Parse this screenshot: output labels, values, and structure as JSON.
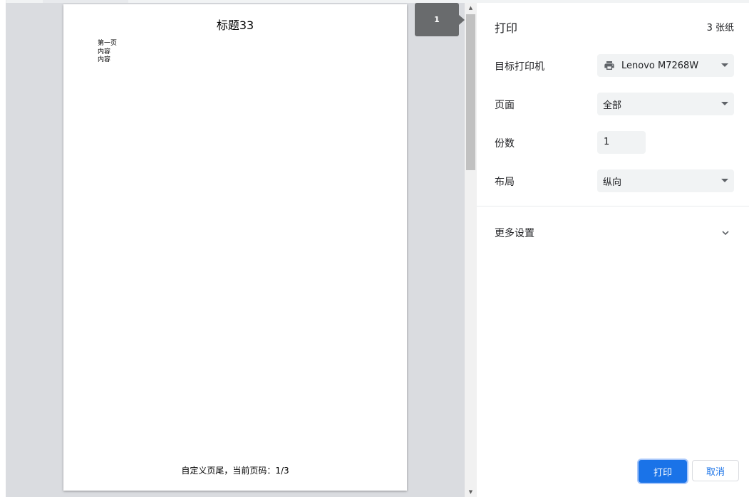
{
  "preview": {
    "page_title": "标题33",
    "body_lines": [
      "第一页",
      "内容",
      "内容"
    ],
    "footer": "自定义页尾，当前页码：1/3",
    "page_badge": "1"
  },
  "panel": {
    "title": "打印",
    "sheet_count": "3 张纸",
    "destination": {
      "label": "目标打印机",
      "value": "Lenovo M7268W",
      "icon": "printer-icon"
    },
    "pages": {
      "label": "页面",
      "value": "全部"
    },
    "copies": {
      "label": "份数",
      "value": "1"
    },
    "layout": {
      "label": "布局",
      "value": "纵向"
    },
    "more_settings": "更多设置",
    "print_button": "打印",
    "cancel_button": "取消"
  },
  "colors": {
    "accent": "#1a73e8",
    "preview_bg": "#dadce0",
    "badge": "#696b6d"
  }
}
